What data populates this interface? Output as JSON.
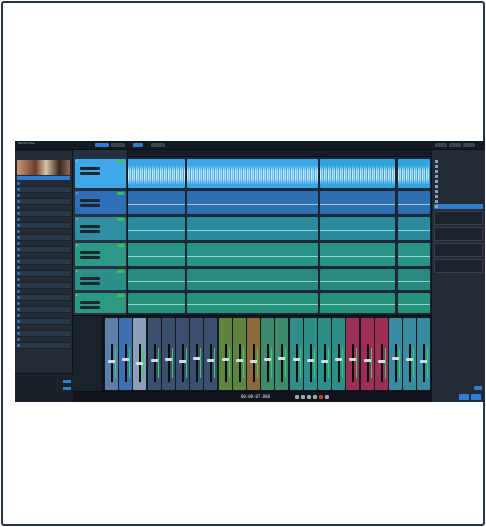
{
  "app": {
    "title": "Studio One",
    "toolbar": {
      "buttons": [
        "",
        "",
        "",
        ""
      ],
      "right_buttons": [
        "",
        "",
        ""
      ]
    }
  },
  "browser": {
    "header": "",
    "items": [
      "",
      "",
      "",
      "",
      "",
      "",
      "",
      "",
      "",
      "",
      "",
      "",
      "",
      "",
      "",
      "",
      "",
      "",
      "",
      "",
      "",
      "",
      "",
      "",
      "",
      "",
      "",
      ""
    ]
  },
  "tracks": {
    "header": "",
    "list": [
      {
        "num": "1",
        "name": "",
        "color": "#3fa8e8"
      },
      {
        "num": "2",
        "name": "",
        "color": "#2f6fb8"
      },
      {
        "num": "3",
        "name": "",
        "color": "#2f8fa0"
      },
      {
        "num": "4",
        "name": "",
        "color": "#2c9a86"
      },
      {
        "num": "5",
        "name": "",
        "color": "#2c8f8a"
      },
      {
        "num": "6",
        "name": "",
        "color": "#2c9a80"
      }
    ]
  },
  "arrange": {
    "ruler_ticks": [
      "",
      "",
      "",
      "",
      "",
      "",
      "",
      "",
      "",
      "",
      ""
    ],
    "clips": [
      {
        "lane": 0,
        "start": 0.0,
        "end": 0.19,
        "name": "",
        "type": "audio",
        "color": "#3aa6ea"
      },
      {
        "lane": 0,
        "start": 0.195,
        "end": 0.63,
        "name": "",
        "type": "audio",
        "color": "#3aa6ea"
      },
      {
        "lane": 0,
        "start": 0.635,
        "end": 0.885,
        "name": "",
        "type": "audio",
        "color": "#2fa3e0"
      },
      {
        "lane": 0,
        "start": 0.89,
        "end": 1.0,
        "name": "",
        "type": "audio",
        "color": "#2fa3e0"
      },
      {
        "lane": 1,
        "start": 0.0,
        "end": 0.19,
        "name": "",
        "type": "inst",
        "color": "#2e6fb4"
      },
      {
        "lane": 1,
        "start": 0.195,
        "end": 0.63,
        "name": "",
        "type": "inst",
        "color": "#2e6fb4"
      },
      {
        "lane": 1,
        "start": 0.635,
        "end": 0.885,
        "name": "",
        "type": "inst",
        "color": "#2e6fb4"
      },
      {
        "lane": 1,
        "start": 0.89,
        "end": 1.0,
        "name": "",
        "type": "inst",
        "color": "#2e6fb4"
      },
      {
        "lane": 2,
        "start": 0.0,
        "end": 0.19,
        "name": "",
        "type": "inst",
        "color": "#2a8aa0"
      },
      {
        "lane": 2,
        "start": 0.195,
        "end": 0.63,
        "name": "",
        "type": "inst",
        "color": "#2a8aa0"
      },
      {
        "lane": 2,
        "start": 0.635,
        "end": 0.885,
        "name": "",
        "type": "inst",
        "color": "#2a8aa0"
      },
      {
        "lane": 2,
        "start": 0.89,
        "end": 1.0,
        "name": "",
        "type": "inst",
        "color": "#2a8aa0"
      },
      {
        "lane": 3,
        "start": 0.0,
        "end": 0.19,
        "name": "",
        "type": "inst",
        "color": "#289488"
      },
      {
        "lane": 3,
        "start": 0.195,
        "end": 0.63,
        "name": "",
        "type": "inst",
        "color": "#289488"
      },
      {
        "lane": 3,
        "start": 0.635,
        "end": 0.885,
        "name": "",
        "type": "inst",
        "color": "#289488"
      },
      {
        "lane": 3,
        "start": 0.89,
        "end": 1.0,
        "name": "",
        "type": "inst",
        "color": "#289488"
      },
      {
        "lane": 4,
        "start": 0.0,
        "end": 0.19,
        "name": "",
        "type": "inst",
        "color": "#27897f"
      },
      {
        "lane": 4,
        "start": 0.195,
        "end": 0.63,
        "name": "",
        "type": "inst",
        "color": "#27897f"
      },
      {
        "lane": 4,
        "start": 0.635,
        "end": 0.885,
        "name": "",
        "type": "inst",
        "color": "#27897f"
      },
      {
        "lane": 4,
        "start": 0.89,
        "end": 1.0,
        "name": "",
        "type": "inst",
        "color": "#27897f"
      },
      {
        "lane": 5,
        "start": 0.0,
        "end": 0.19,
        "name": "",
        "type": "inst",
        "color": "#26917c"
      },
      {
        "lane": 5,
        "start": 0.195,
        "end": 0.63,
        "name": "",
        "type": "inst",
        "color": "#26917c"
      },
      {
        "lane": 5,
        "start": 0.635,
        "end": 0.885,
        "name": "",
        "type": "inst",
        "color": "#26917c"
      },
      {
        "lane": 5,
        "start": 0.89,
        "end": 1.0,
        "name": "",
        "type": "inst",
        "color": "#26917c"
      }
    ]
  },
  "inspector": {
    "header": "",
    "items": [
      "",
      "",
      "",
      "",
      "",
      "",
      "",
      "",
      "",
      ""
    ],
    "selected_index": 9
  },
  "mixer": {
    "channels": [
      {
        "color": "#5b7fa8",
        "level": 0.55
      },
      {
        "color": "#3e6fb0",
        "level": 0.6
      },
      {
        "color": "#8aa0b8",
        "level": 0.5
      },
      {
        "color": "#3b4f6e",
        "level": 0.58
      },
      {
        "color": "#3b4f6e",
        "level": 0.6
      },
      {
        "color": "#3b4f6e",
        "level": 0.55
      },
      {
        "color": "#3b4f6e",
        "level": 0.62
      },
      {
        "color": "#3b4f6e",
        "level": 0.57
      },
      {
        "color": "#5e8440",
        "level": 0.6
      },
      {
        "color": "#5e8440",
        "level": 0.58
      },
      {
        "color": "#8b6b3a",
        "level": 0.55
      },
      {
        "color": "#3e8a6a",
        "level": 0.6
      },
      {
        "color": "#3e8a6a",
        "level": 0.62
      },
      {
        "color": "#2f8f88",
        "level": 0.6
      },
      {
        "color": "#2f8f88",
        "level": 0.58
      },
      {
        "color": "#2f8f88",
        "level": 0.55
      },
      {
        "color": "#2f8f88",
        "level": 0.6
      },
      {
        "color": "#9c2f55",
        "level": 0.6
      },
      {
        "color": "#9c2f55",
        "level": 0.57
      },
      {
        "color": "#9c2f55",
        "level": 0.55
      },
      {
        "color": "#3a8aa0",
        "level": 0.62
      },
      {
        "color": "#3a8aa0",
        "level": 0.6
      },
      {
        "color": "#3a8aa0",
        "level": 0.55
      }
    ]
  },
  "transport": {
    "time": "00:00:07.888"
  },
  "colors": {
    "accent": "#2f7fd0",
    "meter": "#35d06a",
    "background": "#1d2530"
  }
}
